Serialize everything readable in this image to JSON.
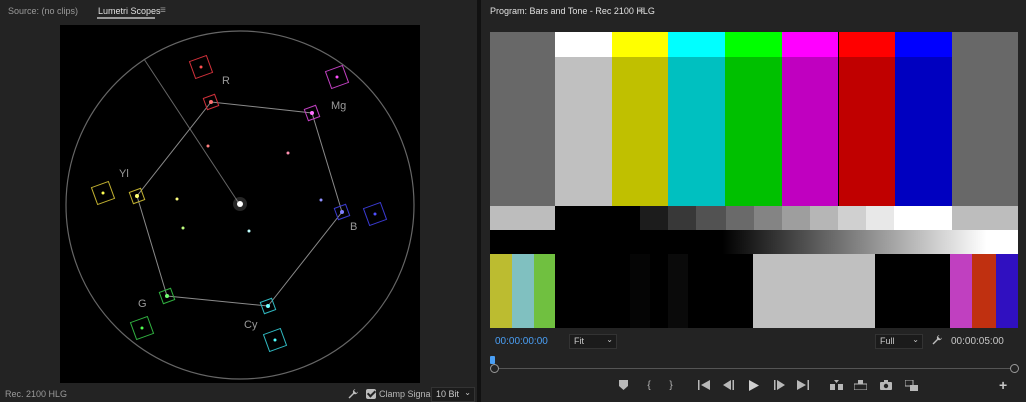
{
  "source_tab": {
    "label": "Source: (no clips)"
  },
  "scopes_tab": {
    "label": "Lumetri Scopes"
  },
  "program_tab": {
    "label": "Program: Bars and Tone - Rec 2100 HLG"
  },
  "menu_icon": "≡",
  "vectorscope": {
    "labels": {
      "r": "R",
      "mg": "Mg",
      "b": "B",
      "cy": "Cy",
      "g": "G",
      "yl": "Yl"
    },
    "colors": {
      "r": "#d0303a",
      "mg": "#c040c0",
      "b": "#3a3ad0",
      "cy": "#30b8c0",
      "g": "#30b040",
      "yl": "#c0b030"
    }
  },
  "left_status": {
    "color_space": "Rec. 2100 HLG",
    "clamp_label": "Clamp Signal",
    "clamp_checked": true,
    "bit_depth": "10 Bit"
  },
  "program": {
    "timecode_in": "00:00:00:00",
    "zoom": "Fit",
    "resolution": "Full",
    "timecode_out": "00:00:05:00"
  },
  "colors": {
    "bars_top": [
      "#ffffff",
      "#ffff00",
      "#00ffff",
      "#00ff00",
      "#ff00ff",
      "#ff0000",
      "#0000ff"
    ],
    "bars_main": [
      "#c0c0c0",
      "#c0c000",
      "#00c0c0",
      "#00c000",
      "#c000c0",
      "#c00000",
      "#0000c0"
    ],
    "side_gray": "#686868",
    "accent": "#4a9ff5"
  }
}
